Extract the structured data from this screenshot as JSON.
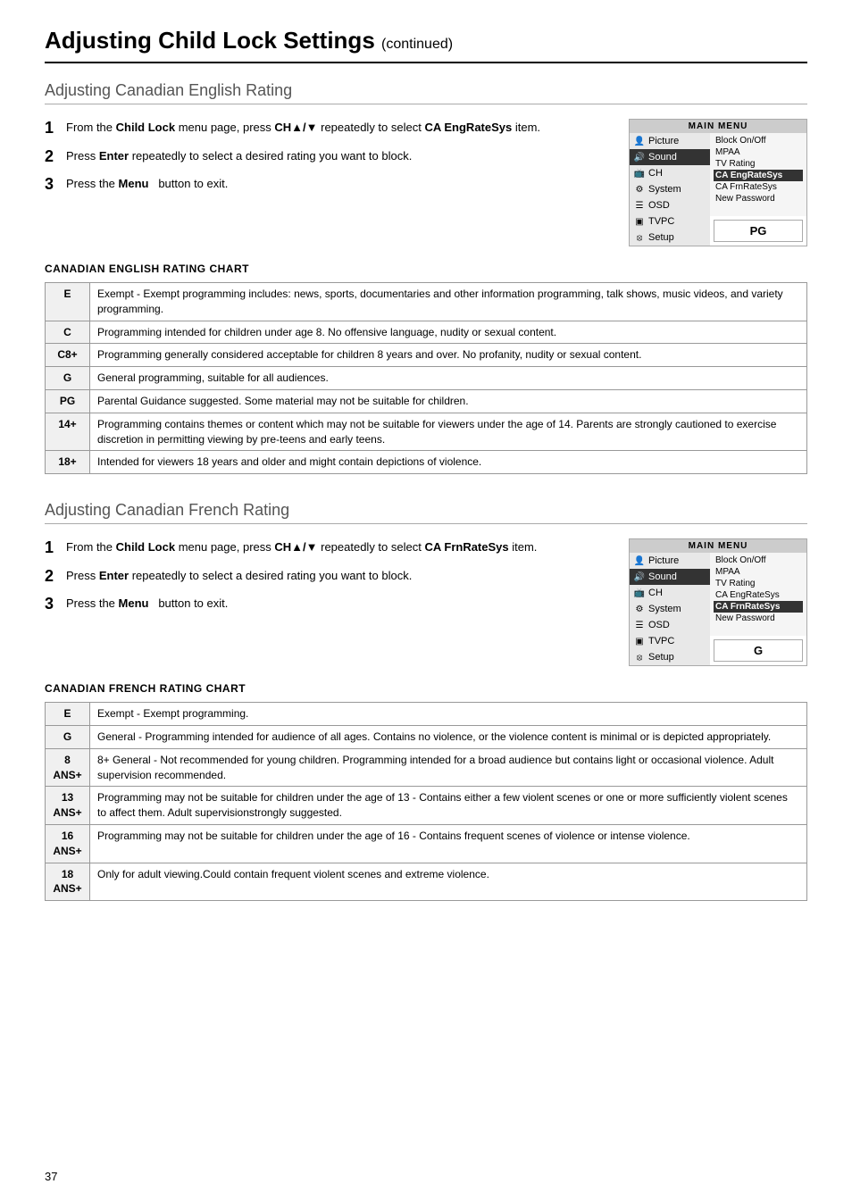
{
  "page": {
    "title": "Adjusting Child Lock Settings",
    "continued": "(continued)",
    "page_number": "37"
  },
  "section1": {
    "title": "Adjusting Canadian English Rating",
    "steps": [
      {
        "num": "1",
        "text": "From the ",
        "bold1": "Child Lock",
        "text2": " menu page, press ",
        "bold2": "CH▲/▼",
        "text3": " repeatedly to select ",
        "bold3": "CA EngRateSys",
        "text4": " item."
      },
      {
        "num": "2",
        "text": "Press ",
        "bold1": "Enter",
        "text2": " repeatedly to select a desired rating you want to block."
      },
      {
        "num": "3",
        "text": "Press the ",
        "bold1": "Menu",
        "text2": "  button to exit."
      }
    ],
    "menu": {
      "header": "MAIN MENU",
      "items": [
        {
          "icon": "👤",
          "label": "Picture",
          "highlighted": false
        },
        {
          "icon": "🔊",
          "label": "Sound",
          "highlighted": false
        },
        {
          "icon": "📺",
          "label": "CH",
          "highlighted": false
        },
        {
          "icon": "⚙",
          "label": "System",
          "highlighted": false
        },
        {
          "icon": "≡",
          "label": "OSD",
          "highlighted": false
        },
        {
          "icon": "▣",
          "label": "TVPC",
          "highlighted": false
        },
        {
          "icon": "⟳",
          "label": "Setup",
          "highlighted": false
        }
      ],
      "submenu": [
        {
          "label": "Block On/Off",
          "highlighted": false
        },
        {
          "label": "MPAA",
          "highlighted": false
        },
        {
          "label": "TV Rating",
          "highlighted": false
        },
        {
          "label": "CA EngRateSys",
          "highlighted": true
        },
        {
          "label": "CA FrnRateSys",
          "highlighted": false
        },
        {
          "label": "New Password",
          "highlighted": false
        }
      ],
      "rating_value": "PG"
    },
    "chart_title": "CANADIAN ENGLISH RATING CHART",
    "rows": [
      {
        "code": "E",
        "desc": "Exempt - Exempt programming includes: news, sports, documentaries and other information programming, talk shows, music videos, and variety programming."
      },
      {
        "code": "C",
        "desc": "Programming intended for children under age 8. No offensive language, nudity or sexual content."
      },
      {
        "code": "C8+",
        "desc": "Programming generally considered acceptable for children 8 years and over. No profanity, nudity or sexual content."
      },
      {
        "code": "G",
        "desc": "General programming, suitable for all audiences."
      },
      {
        "code": "PG",
        "desc": "Parental Guidance suggested. Some material may not be suitable for children."
      },
      {
        "code": "14+",
        "desc": "Programming contains themes or content which may not be suitable for viewers under the age of 14. Parents are strongly cautioned to exercise discretion in permitting viewing by pre-teens and early teens."
      },
      {
        "code": "18+",
        "desc": "Intended for viewers 18 years and older and might contain depictions of violence."
      }
    ]
  },
  "section2": {
    "title": "Adjusting Canadian French Rating",
    "steps": [
      {
        "num": "1",
        "text": "From the ",
        "bold1": "Child Lock",
        "text2": " menu page, press ",
        "bold2": "CH▲/▼",
        "text3": " repeatedly to select ",
        "bold3": "CA FrnRateSys",
        "text4": " item."
      },
      {
        "num": "2",
        "text": "Press ",
        "bold1": "Enter",
        "text2": " repeatedly to select a desired rating you want to block."
      },
      {
        "num": "3",
        "text": "Press the ",
        "bold1": "Menu",
        "text2": "  button to exit."
      }
    ],
    "menu": {
      "header": "MAIN MENU",
      "items": [
        {
          "icon": "👤",
          "label": "Picture",
          "highlighted": false
        },
        {
          "icon": "🔊",
          "label": "Sound",
          "highlighted": false
        },
        {
          "icon": "📺",
          "label": "CH",
          "highlighted": false
        },
        {
          "icon": "⚙",
          "label": "System",
          "highlighted": false
        },
        {
          "icon": "≡",
          "label": "OSD",
          "highlighted": false
        },
        {
          "icon": "▣",
          "label": "TVPC",
          "highlighted": false
        },
        {
          "icon": "⟳",
          "label": "Setup",
          "highlighted": false
        }
      ],
      "submenu": [
        {
          "label": "Block On/Off",
          "highlighted": false
        },
        {
          "label": "MPAA",
          "highlighted": false
        },
        {
          "label": "TV Rating",
          "highlighted": false
        },
        {
          "label": "CA EngRateSys",
          "highlighted": false
        },
        {
          "label": "CA FrnRateSys",
          "highlighted": true
        },
        {
          "label": "New Password",
          "highlighted": false
        }
      ],
      "rating_value": "G"
    },
    "chart_title": "CANADIAN FRENCH RATING CHART",
    "rows": [
      {
        "code": "E",
        "desc": "Exempt - Exempt programming."
      },
      {
        "code": "G",
        "desc": "General - Programming intended for audience of all ages. Contains no violence, or the violence content is minimal or is depicted appropriately."
      },
      {
        "code": "8 ANS+",
        "desc": "8+ General - Not recommended for young children. Programming intended for a broad audience but contains light or occasional violence. Adult supervision recommended."
      },
      {
        "code": "13 ANS+",
        "desc": "Programming may not be suitable for children under the age of 13 - Contains either a few violent scenes or one or more sufficiently violent scenes to affect them. Adult supervisionstrongly suggested."
      },
      {
        "code": "16 ANS+",
        "desc": "Programming may not be suitable for children under the age of 16 - Contains frequent scenes of violence or intense violence."
      },
      {
        "code": "18 ANS+",
        "desc": "Only for adult viewing.Could contain frequent violent scenes and extreme violence."
      }
    ]
  }
}
